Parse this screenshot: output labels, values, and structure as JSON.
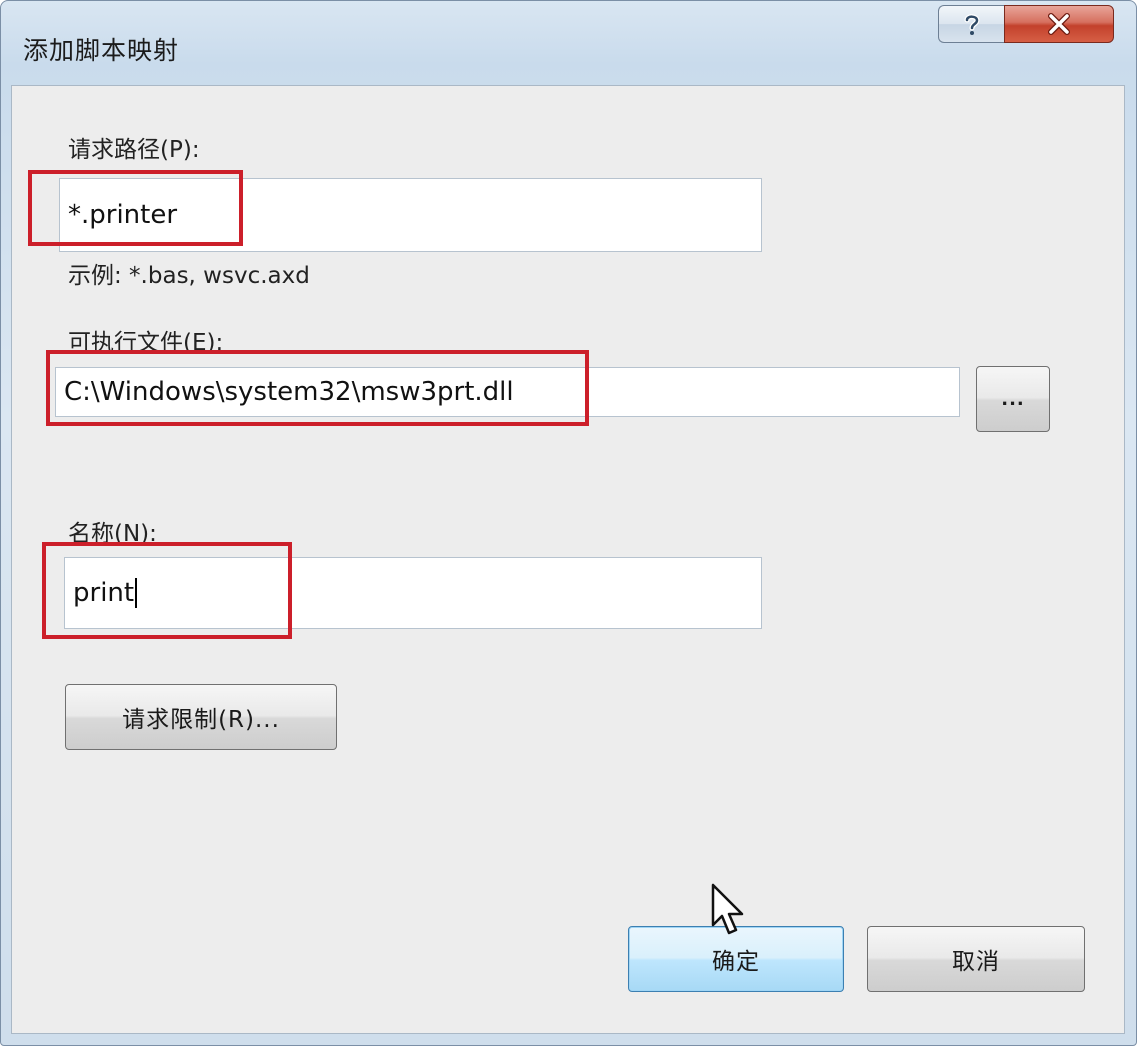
{
  "window": {
    "title": "添加脚本映射",
    "help_icon": "question-mark-icon",
    "close_icon": "close-x-icon"
  },
  "request_path": {
    "label": "请求路径(P):",
    "value": "*.printer",
    "example": "示例: *.bas, wsvc.axd"
  },
  "executable": {
    "label": "可执行文件(E):",
    "value": "C:\\Windows\\system32\\msw3prt.dll",
    "browse_label": "..."
  },
  "name": {
    "label": "名称(N):",
    "value": "print"
  },
  "request_restrictions_button": "请求限制(R)...",
  "buttons": {
    "ok": "确定",
    "cancel": "取消"
  },
  "annotation_color": "#cc1f2a"
}
